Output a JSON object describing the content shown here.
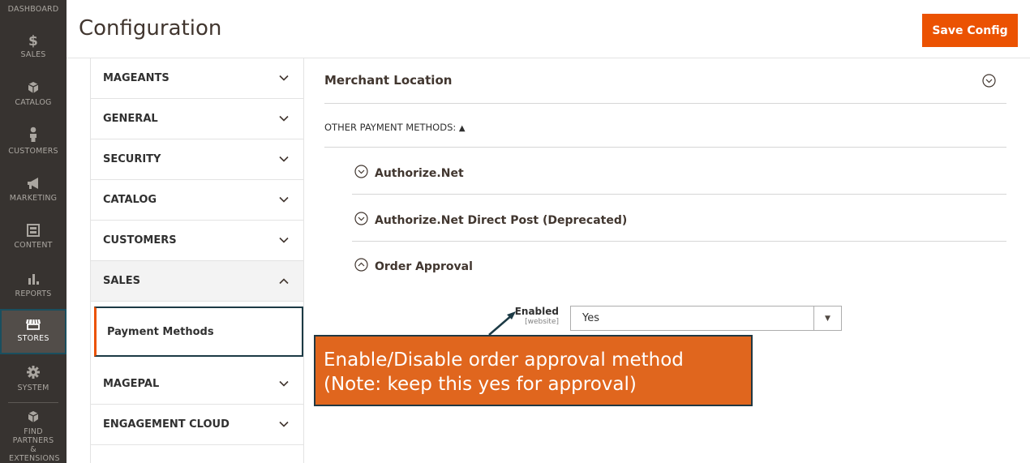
{
  "nav": {
    "items": [
      {
        "label": "DASHBOARD",
        "icon": "dashboard-icon"
      },
      {
        "label": "SALES",
        "icon": "dollar-icon"
      },
      {
        "label": "CATALOG",
        "icon": "cube-icon"
      },
      {
        "label": "CUSTOMERS",
        "icon": "person-icon"
      },
      {
        "label": "MARKETING",
        "icon": "megaphone-icon"
      },
      {
        "label": "CONTENT",
        "icon": "layout-icon"
      },
      {
        "label": "REPORTS",
        "icon": "bar-chart-icon"
      },
      {
        "label": "STORES",
        "icon": "store-icon"
      },
      {
        "label": "SYSTEM",
        "icon": "gear-icon"
      },
      {
        "label": "FIND PARTNERS & EXTENSIONS",
        "icon": "box-icon"
      }
    ],
    "active": "STORES"
  },
  "header": {
    "title": "Configuration",
    "save_label": "Save Config"
  },
  "tabs": [
    {
      "label": "MAGEANTS",
      "state": "collapsed"
    },
    {
      "label": "GENERAL",
      "state": "collapsed"
    },
    {
      "label": "SECURITY",
      "state": "collapsed"
    },
    {
      "label": "CATALOG",
      "state": "collapsed"
    },
    {
      "label": "CUSTOMERS",
      "state": "collapsed"
    },
    {
      "label": "SALES",
      "state": "expanded"
    },
    {
      "label": "MAGEPAL",
      "state": "collapsed"
    },
    {
      "label": "ENGAGEMENT CLOUD",
      "state": "collapsed"
    }
  ],
  "subtab": {
    "label": "Payment Methods"
  },
  "main": {
    "section_title": "Merchant Location",
    "other_methods_label": "OTHER PAYMENT METHODS:",
    "other_methods_toggle": "▲",
    "groups": [
      {
        "title": "Authorize.Net",
        "state": "collapsed"
      },
      {
        "title": "Authorize.Net Direct Post (Deprecated)",
        "state": "collapsed"
      },
      {
        "title": "Order Approval",
        "state": "expanded"
      }
    ],
    "field": {
      "label": "Enabled",
      "scope": "[website]",
      "value": "Yes"
    }
  },
  "annotation": {
    "line1": "Enable/Disable order approval method",
    "line2": "(Note: keep this yes for approval)"
  },
  "colors": {
    "accent": "#eb5202",
    "nav_bg": "#373330",
    "annotation_bg": "#e0661e",
    "annotation_border": "#213842"
  }
}
